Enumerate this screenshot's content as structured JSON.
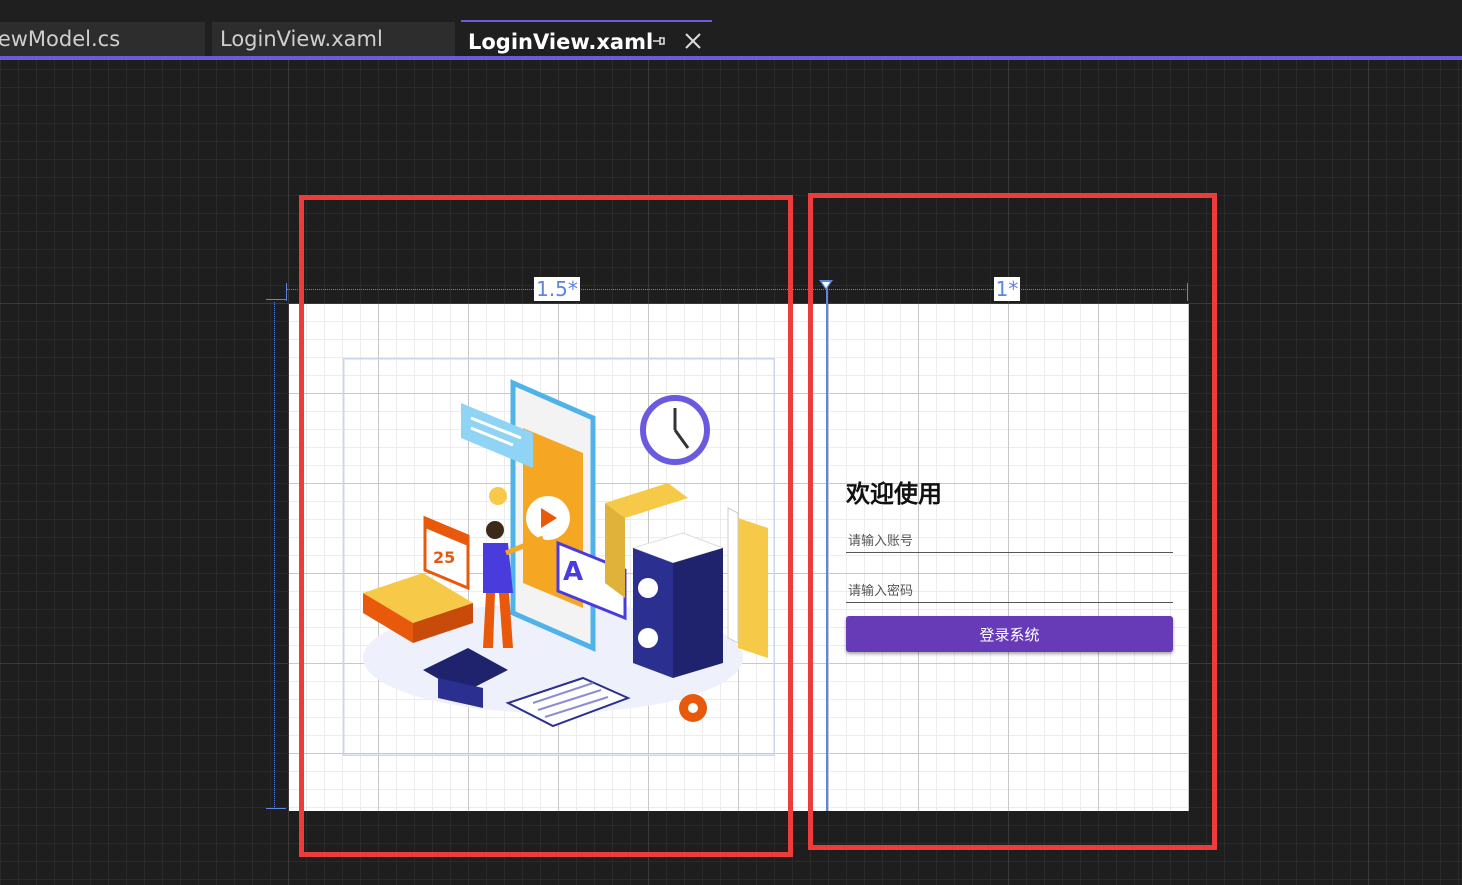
{
  "tabs": [
    {
      "label": "iewModel.cs",
      "active": false
    },
    {
      "label": "LoginView.xaml",
      "active": false
    },
    {
      "label": "LoginView.xaml",
      "active": true
    }
  ],
  "designer": {
    "column_labels": [
      "1.5*",
      "1*"
    ]
  },
  "login": {
    "welcome": "欢迎使用",
    "account_placeholder": "请输入账号",
    "password_placeholder": "请输入密码",
    "login_button": "登录系统"
  },
  "illustration": {
    "calendar_number": "25",
    "card_letter": "A"
  },
  "colors": {
    "accent": "#6b5bd6",
    "button": "#673ab7",
    "highlight": "#ee3b3b",
    "guide": "#5c86e0"
  }
}
